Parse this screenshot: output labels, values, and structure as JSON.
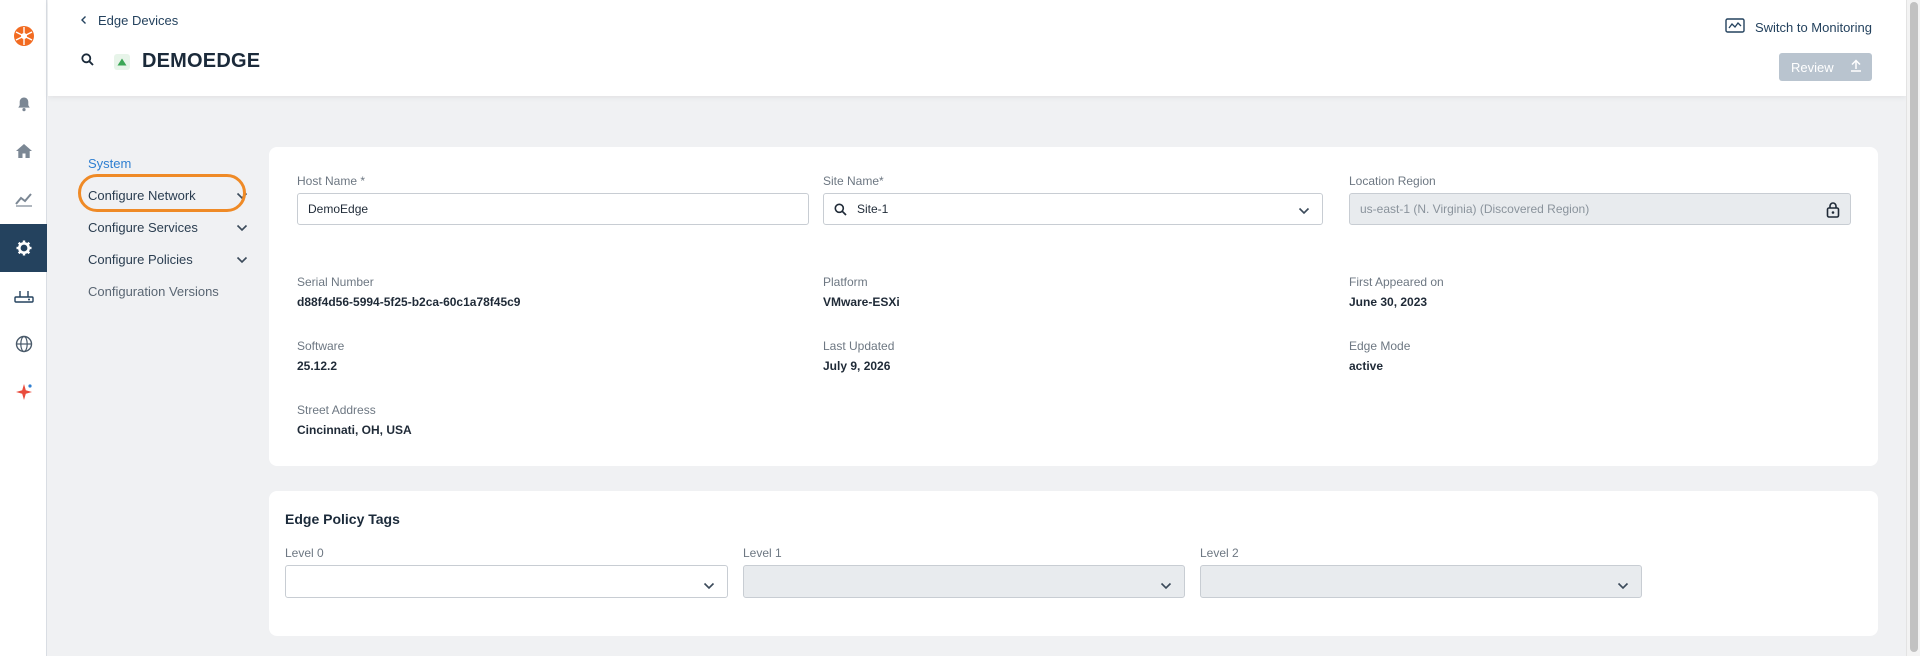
{
  "header": {
    "breadcrumb": "Edge Devices",
    "title": "DEMOEDGE",
    "monitoring_link": "Switch to Monitoring",
    "review_button": "Review"
  },
  "rail": {
    "items": [
      "logo-icon",
      "bell-icon",
      "home-icon",
      "chart-icon",
      "gear-icon",
      "router-icon",
      "globe-icon",
      "sparkle-icon"
    ],
    "active": "gear-icon"
  },
  "sidenav": {
    "items": [
      {
        "label": "System",
        "active": true
      },
      {
        "label": "Configure Network",
        "expandable": true,
        "highlighted": true
      },
      {
        "label": "Configure Services",
        "expandable": true
      },
      {
        "label": "Configure Policies",
        "expandable": true
      },
      {
        "label": "Configuration Versions"
      }
    ]
  },
  "system": {
    "host_name_label": "Host Name *",
    "host_name_value": "DemoEdge",
    "site_name_label": "Site Name*",
    "site_name_value": "Site-1",
    "location_label": "Location Region",
    "location_value": "us-east-1 (N. Virginia) (Discovered Region)",
    "details": [
      {
        "label": "Serial Number",
        "value": "d88f4d56-5994-5f25-b2ca-60c1a78f45c9"
      },
      {
        "label": "Platform",
        "value": "VMware-ESXi"
      },
      {
        "label": "First Appeared on",
        "value": "June 30, 2023"
      },
      {
        "label": "Software",
        "value": "25.12.2"
      },
      {
        "label": "Last Updated",
        "value": "July 9, 2026"
      },
      {
        "label": "Edge Mode",
        "value": "active"
      },
      {
        "label": "Street Address",
        "value": "Cincinnati, OH, USA"
      }
    ]
  },
  "tags": {
    "title": "Edge Policy Tags",
    "levels": [
      {
        "label": "Level 0",
        "value": "",
        "disabled": false
      },
      {
        "label": "Level 1",
        "value": "",
        "disabled": true
      },
      {
        "label": "Level 2",
        "value": "",
        "disabled": true
      }
    ]
  },
  "colors": {
    "accent": "#24425e",
    "link_active": "#2f7fd1",
    "highlight": "#ef8a26",
    "logo": "#f26b21"
  }
}
